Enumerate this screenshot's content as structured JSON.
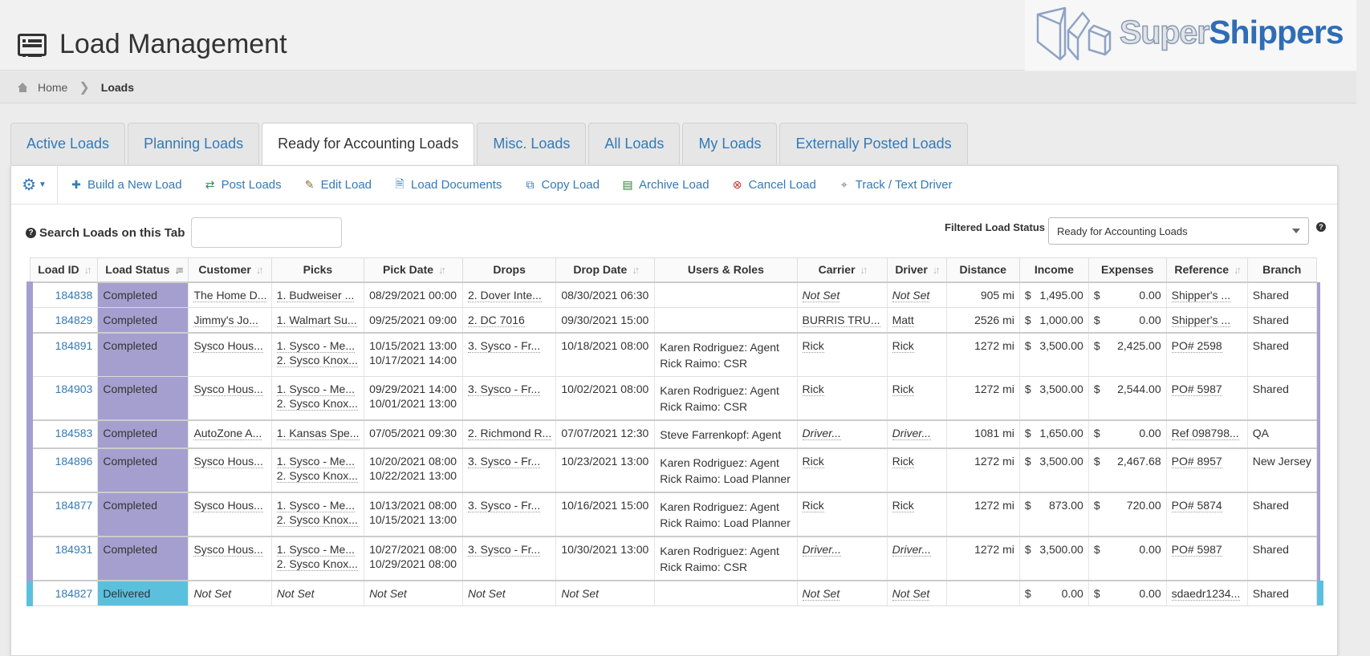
{
  "header": {
    "title": "Load Management"
  },
  "logo": {
    "part1": "Super",
    "part2": "Shippers"
  },
  "breadcrumb": {
    "home": "Home",
    "separator": "❯",
    "current": "Loads"
  },
  "tabs": [
    {
      "label": "Active Loads"
    },
    {
      "label": "Planning Loads"
    },
    {
      "label": "Ready for Accounting Loads",
      "active": true
    },
    {
      "label": "Misc. Loads"
    },
    {
      "label": "All Loads"
    },
    {
      "label": "My Loads"
    },
    {
      "label": "Externally Posted Loads"
    }
  ],
  "toolbar": {
    "build": "Build a New Load",
    "post": "Post Loads",
    "edit": "Edit Load",
    "documents": "Load Documents",
    "copy": "Copy Load",
    "archive": "Archive Load",
    "cancel": "Cancel Load",
    "track": "Track / Text Driver"
  },
  "search": {
    "label": "Search Loads on this Tab",
    "value": ""
  },
  "filter": {
    "label": "Filtered Load Status",
    "value": "Ready for Accounting Loads"
  },
  "colors": {
    "completed": "#a59fcf",
    "delivered": "#5bc0de",
    "link": "#337ab7",
    "brand": "#2f6db5"
  },
  "table": {
    "columns": [
      "Load ID",
      "Load Status",
      "Customer",
      "Picks",
      "Pick Date",
      "Drops",
      "Drop Date",
      "Users & Roles",
      "Carrier",
      "Driver",
      "Distance",
      "Income",
      "Expenses",
      "Reference",
      "Branch"
    ],
    "rows": [
      {
        "id": "184838",
        "status": "Completed",
        "customer": "The Home D...",
        "picks": [
          "1. Budweiser ..."
        ],
        "pick_dates": [
          "08/29/2021 00:00"
        ],
        "drops": "2. Dover Inte...",
        "drop_date": "08/30/2021 06:30",
        "users": [],
        "carrier": "Not Set",
        "driver": "Not Set",
        "distance": "905 mi",
        "income": "1,495.00",
        "expenses": "0.00",
        "reference": "Shipper's ...",
        "branch": "Shared"
      },
      {
        "id": "184829",
        "status": "Completed",
        "customer": "Jimmy's Jo...",
        "picks": [
          "1. Walmart Su..."
        ],
        "pick_dates": [
          "09/25/2021 09:00"
        ],
        "drops": "2. DC 7016",
        "drop_date": "09/30/2021 15:00",
        "users": [],
        "carrier": "BURRIS TRU...",
        "driver": "Matt",
        "distance": "2526 mi",
        "income": "1,000.00",
        "expenses": "0.00",
        "reference": "Shipper's ...",
        "branch": "Shared"
      },
      {
        "id": "184891",
        "status": "Completed",
        "customer": "Sysco Hous...",
        "picks": [
          "1. Sysco - Me...",
          "2. Sysco Knox..."
        ],
        "pick_dates": [
          "10/15/2021 13:00",
          "10/17/2021 14:00"
        ],
        "drops": "3. Sysco - Fr...",
        "drop_date": "10/18/2021 08:00",
        "users": [
          "Karen Rodriguez: Agent",
          "Rick Raimo: CSR"
        ],
        "carrier": "Rick",
        "driver": "Rick",
        "distance": "1272 mi",
        "income": "3,500.00",
        "expenses": "2,425.00",
        "reference": "PO# 2598",
        "branch": "Shared"
      },
      {
        "id": "184903",
        "status": "Completed",
        "customer": "Sysco Hous...",
        "picks": [
          "1. Sysco - Me...",
          "2. Sysco Knox..."
        ],
        "pick_dates": [
          "09/29/2021 14:00",
          "10/01/2021 13:00"
        ],
        "drops": "3. Sysco - Fr...",
        "drop_date": "10/02/2021 08:00",
        "users": [
          "Karen Rodriguez: Agent",
          "Rick Raimo: CSR"
        ],
        "carrier": "Rick",
        "driver": "Rick",
        "distance": "1272 mi",
        "income": "3,500.00",
        "expenses": "2,544.00",
        "reference": "PO# 5987",
        "branch": "Shared"
      },
      {
        "id": "184583",
        "status": "Completed",
        "customer": "AutoZone A...",
        "picks": [
          "1. Kansas Spe..."
        ],
        "pick_dates": [
          "07/05/2021 09:30"
        ],
        "drops": "2. Richmond R...",
        "drop_date": "07/07/2021 12:30",
        "users": [
          "Steve Farrenkopf: Agent"
        ],
        "carrier": "Driver...",
        "driver": "Driver...",
        "distance": "1081 mi",
        "income": "1,650.00",
        "expenses": "0.00",
        "reference": "Ref 098798...",
        "branch": "QA"
      },
      {
        "id": "184896",
        "status": "Completed",
        "customer": "Sysco Hous...",
        "picks": [
          "1. Sysco - Me...",
          "2. Sysco Knox..."
        ],
        "pick_dates": [
          "10/20/2021 08:00",
          "10/22/2021 13:00"
        ],
        "drops": "3. Sysco - Fr...",
        "drop_date": "10/23/2021 13:00",
        "users": [
          "Karen Rodriguez: Agent",
          "Rick Raimo: Load Planner"
        ],
        "carrier": "Rick",
        "driver": "Rick",
        "distance": "1272 mi",
        "income": "3,500.00",
        "expenses": "2,467.68",
        "reference": "PO# 8957",
        "branch": "New Jersey"
      },
      {
        "id": "184877",
        "status": "Completed",
        "customer": "Sysco Hous...",
        "picks": [
          "1. Sysco - Me...",
          "2. Sysco Knox..."
        ],
        "pick_dates": [
          "10/13/2021 08:00",
          "10/15/2021 13:00"
        ],
        "drops": "3. Sysco - Fr...",
        "drop_date": "10/16/2021 15:00",
        "users": [
          "Karen Rodriguez: Agent",
          "Rick Raimo: Load Planner"
        ],
        "carrier": "Rick",
        "driver": "Rick",
        "distance": "1272 mi",
        "income": "873.00",
        "expenses": "720.00",
        "reference": "PO# 5874",
        "branch": "Shared"
      },
      {
        "id": "184931",
        "status": "Completed",
        "customer": "Sysco Hous...",
        "picks": [
          "1. Sysco - Me...",
          "2. Sysco Knox..."
        ],
        "pick_dates": [
          "10/27/2021 08:00",
          "10/29/2021 08:00"
        ],
        "drops": "3. Sysco - Fr...",
        "drop_date": "10/30/2021 13:00",
        "users": [
          "Karen Rodriguez: Agent",
          "Rick Raimo: CSR"
        ],
        "carrier": "Driver...",
        "driver": "Driver...",
        "distance": "1272 mi",
        "income": "3,500.00",
        "expenses": "0.00",
        "reference": "PO# 5987",
        "branch": "Shared"
      },
      {
        "id": "184827",
        "status": "Delivered",
        "customer": "Not Set",
        "picks": [
          "Not Set"
        ],
        "pick_dates": [
          "Not Set"
        ],
        "drops": "Not Set",
        "drop_date": "Not Set",
        "users": [],
        "carrier": "Not Set",
        "driver": "Not Set",
        "distance": "",
        "income": "0.00",
        "expenses": "0.00",
        "reference": "sdaedr1234...",
        "branch": "Shared"
      }
    ],
    "currency": "$"
  }
}
